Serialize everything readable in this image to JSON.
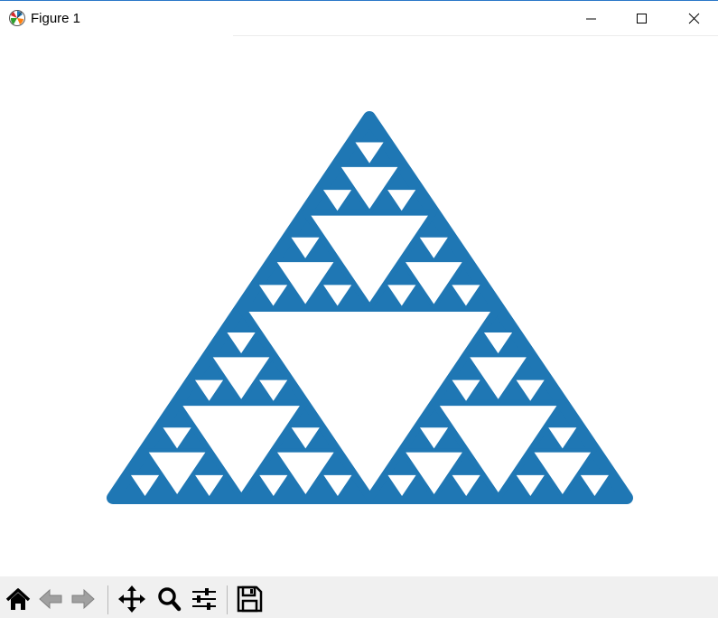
{
  "window": {
    "title": "Figure 1",
    "icon": "matplotlib-icon",
    "controls": [
      "minimize",
      "maximize",
      "close"
    ]
  },
  "figure": {
    "content": "sierpinski-triangle-scatter",
    "point_color": "#1f77b4",
    "recursion_levels": 4
  },
  "toolbar": {
    "buttons": [
      "home",
      "back",
      "forward",
      "pan",
      "zoom",
      "configure-subplots",
      "save"
    ]
  }
}
